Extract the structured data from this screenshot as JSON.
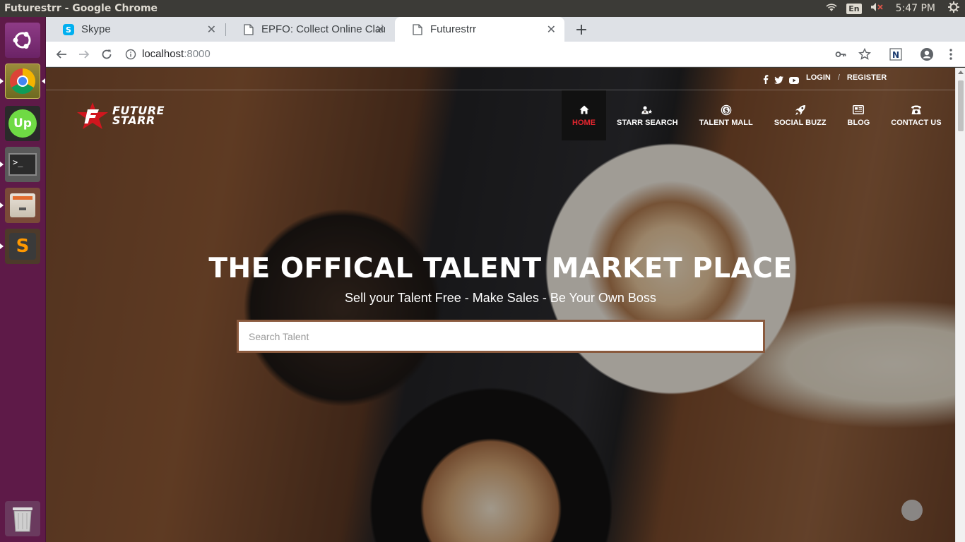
{
  "window": {
    "title": "Futurestrr - Google Chrome"
  },
  "panel": {
    "language": "En",
    "time": "5:47 PM"
  },
  "launcher": {
    "items": [
      {
        "name": "ubuntu-dash"
      },
      {
        "name": "chrome"
      },
      {
        "name": "upwork",
        "label": "Up"
      },
      {
        "name": "terminal",
        "label": ">_"
      },
      {
        "name": "files"
      },
      {
        "name": "sublime-text",
        "label": "S"
      },
      {
        "name": "trash"
      }
    ]
  },
  "tabs": [
    {
      "title": "Skype",
      "active": false
    },
    {
      "title": "EPFO: Collect Online Clair",
      "active": false
    },
    {
      "title": "Futurestrr",
      "active": true
    }
  ],
  "address": {
    "host": "localhost",
    "port": ":8000"
  },
  "site": {
    "auth": {
      "login": "LOGIN",
      "separator": "/",
      "register": "REGISTER"
    },
    "logo": {
      "line1": "FUTURE",
      "line2": "STARR"
    },
    "nav": [
      {
        "label": "HOME",
        "icon": "home-icon",
        "active": true
      },
      {
        "label": "STARR SEARCH",
        "icon": "user-star-icon",
        "active": false
      },
      {
        "label": "TALENT MALL",
        "icon": "dollar-circle-icon",
        "active": false
      },
      {
        "label": "SOCIAL BUZZ",
        "icon": "rocket-icon",
        "active": false
      },
      {
        "label": "BLOG",
        "icon": "newspaper-icon",
        "active": false
      },
      {
        "label": "CONTACT US",
        "icon": "phone-icon",
        "active": false
      }
    ],
    "hero": {
      "title": "THE OFFICAL TALENT MARKET PLACE",
      "subtitle": "Sell your Talent Free - Make Sales - Be Your Own Boss",
      "search_placeholder": "Search Talent",
      "search_value": ""
    }
  },
  "colors": {
    "launcher_bg": "#5e1a48",
    "panel_bg": "#3c3b37",
    "nav_active": "#e5262f",
    "search_border": "#8a5a3e"
  }
}
